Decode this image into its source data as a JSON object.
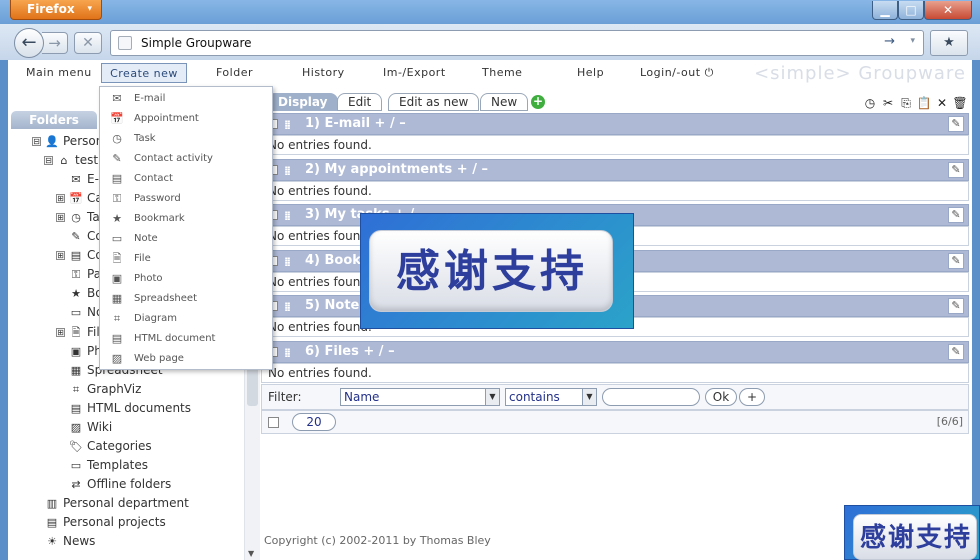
{
  "browser": {
    "menu_button": "Firefox",
    "menu_arrow": "▾",
    "url": "Simple Groupware",
    "go_icon": "→",
    "url_drop_icon": "▾",
    "back_icon": "←",
    "forward_icon": "→",
    "stop_icon": "✕",
    "bookmark_icon": "★",
    "minimize_icon": "▁",
    "maximize_icon": "□",
    "close_icon": "✕"
  },
  "app_menu": {
    "items": [
      "Main menu",
      "Create new",
      "Folder",
      "History",
      "Im-/Export",
      "Theme",
      "Help",
      "Login/-out"
    ],
    "login_icon": "⏻",
    "logo": "<simple> Groupware"
  },
  "create_menu": {
    "items": [
      "E-mail",
      "Appointment",
      "Task",
      "Contact activity",
      "Contact",
      "Password",
      "Bookmark",
      "Note",
      "File",
      "Photo",
      "Spreadsheet",
      "Diagram",
      "HTML document",
      "Web page"
    ],
    "icons": [
      "✉",
      "📅",
      "◷",
      "✎",
      "▤",
      "⚿",
      "★",
      "▭",
      "🗎",
      "▣",
      "▦",
      "⌗",
      "▤",
      "▨"
    ]
  },
  "sidebar": {
    "header": "Folders",
    "tree": [
      {
        "label": "Person",
        "expander": "⊟",
        "icon": "👤"
      },
      {
        "label": "test",
        "expander": "⊟",
        "icon": "⌂"
      },
      {
        "label": "E-",
        "expander": "",
        "icon": "✉"
      },
      {
        "label": "Ca",
        "expander": "⊞",
        "icon": "📅"
      },
      {
        "label": "Ta",
        "expander": "⊞",
        "icon": "◷"
      },
      {
        "label": "Co",
        "expander": "",
        "icon": "✎"
      },
      {
        "label": "Co",
        "expander": "⊞",
        "icon": "▤"
      },
      {
        "label": "Pa",
        "expander": "",
        "icon": "⚿"
      },
      {
        "label": "Bo",
        "expander": "",
        "icon": "★"
      },
      {
        "label": "No",
        "expander": "",
        "icon": "▭"
      },
      {
        "label": "Fil",
        "expander": "⊞",
        "icon": "🗎"
      },
      {
        "label": "Ph",
        "expander": "",
        "icon": "▣"
      },
      {
        "label": "Spreadsheet",
        "expander": "",
        "icon": "▦"
      },
      {
        "label": "GraphViz",
        "expander": "",
        "icon": "⌗"
      },
      {
        "label": "HTML documents",
        "expander": "",
        "icon": "▤"
      },
      {
        "label": "Wiki",
        "expander": "",
        "icon": "▨"
      },
      {
        "label": "Categories",
        "expander": "",
        "icon": "🏷"
      },
      {
        "label": "Templates",
        "expander": "",
        "icon": "▭"
      },
      {
        "label": "Offline folders",
        "expander": "",
        "icon": "⇄"
      },
      {
        "label": "Personal department",
        "expander": "",
        "icon": "▥"
      },
      {
        "label": "Personal projects",
        "expander": "",
        "icon": "▤"
      },
      {
        "label": "News",
        "expander": "",
        "icon": "☀"
      }
    ],
    "scroll_down": "▼"
  },
  "main": {
    "tabs": [
      "Display",
      "Edit",
      "Edit as new",
      "New"
    ],
    "add_icon": "+",
    "tool_icons": [
      "◷",
      "✂",
      "⎘",
      "📋",
      "✕",
      "🗑"
    ],
    "sections": [
      {
        "title": "1) E-mail  + / –",
        "body": "No entries found."
      },
      {
        "title": "2) My appointments  + / –",
        "body": "No entries found."
      },
      {
        "title": "3) My tasks  + / –",
        "body": "No entries found."
      },
      {
        "title": "4) Bookmarks  + / –",
        "body": "No entries found."
      },
      {
        "title": "5) Notes  + / –",
        "body": "No entries found."
      },
      {
        "title": "6) Files  + / –",
        "body": "No entries found."
      }
    ],
    "edit_icon": "✎",
    "grip_icon": "⁞⁞",
    "filter": {
      "label": "Filter:",
      "field": "Name",
      "operator": "contains",
      "value": "",
      "ok": "Ok",
      "add": "+",
      "drop_icon": "▼"
    },
    "pagination": {
      "page_size": "20",
      "count": "[6/6]"
    },
    "footer": "Copyright (c) 2002-2011 by Thomas Bley"
  },
  "overlay": {
    "text": "感谢支持"
  }
}
